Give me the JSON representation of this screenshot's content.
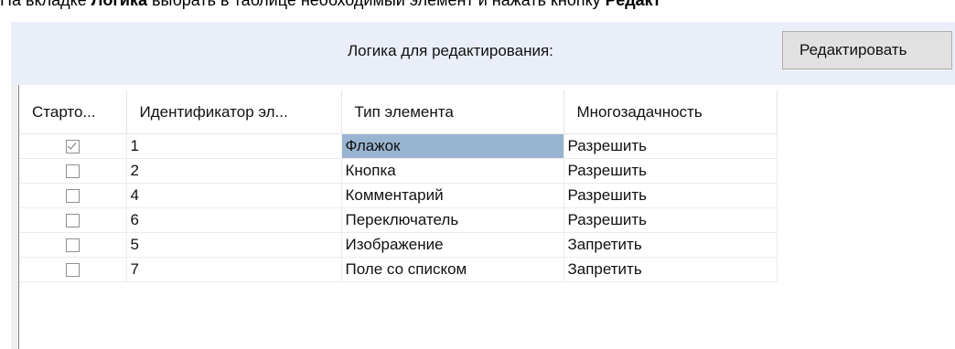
{
  "instruction": {
    "prefix": "На вкладке ",
    "tab_name": "Логика",
    "middle": " выбрать в таблице необходимый элемент и нажать кнопку ",
    "button_name": "Редакт"
  },
  "toolbar": {
    "logic_label": "Логика для редактирования:",
    "edit_button": "Редактировать"
  },
  "table": {
    "columns": [
      "Старто...",
      "Идентификатор эл...",
      "Тип элемента",
      "Многозадачность"
    ],
    "rows": [
      {
        "start": true,
        "id": "1",
        "type": "Флажок",
        "multitask": "Разрешить"
      },
      {
        "start": false,
        "id": "2",
        "type": "Кнопка",
        "multitask": "Разрешить"
      },
      {
        "start": false,
        "id": "4",
        "type": "Комментарий",
        "multitask": "Разрешить"
      },
      {
        "start": false,
        "id": "6",
        "type": "Переключатель",
        "multitask": "Разрешить"
      },
      {
        "start": false,
        "id": "5",
        "type": "Изображение",
        "multitask": "Запретить"
      },
      {
        "start": false,
        "id": "7",
        "type": "Поле со списком",
        "multitask": "Запретить"
      }
    ],
    "selected_row": 0,
    "selected_color": "#99b4d1"
  }
}
